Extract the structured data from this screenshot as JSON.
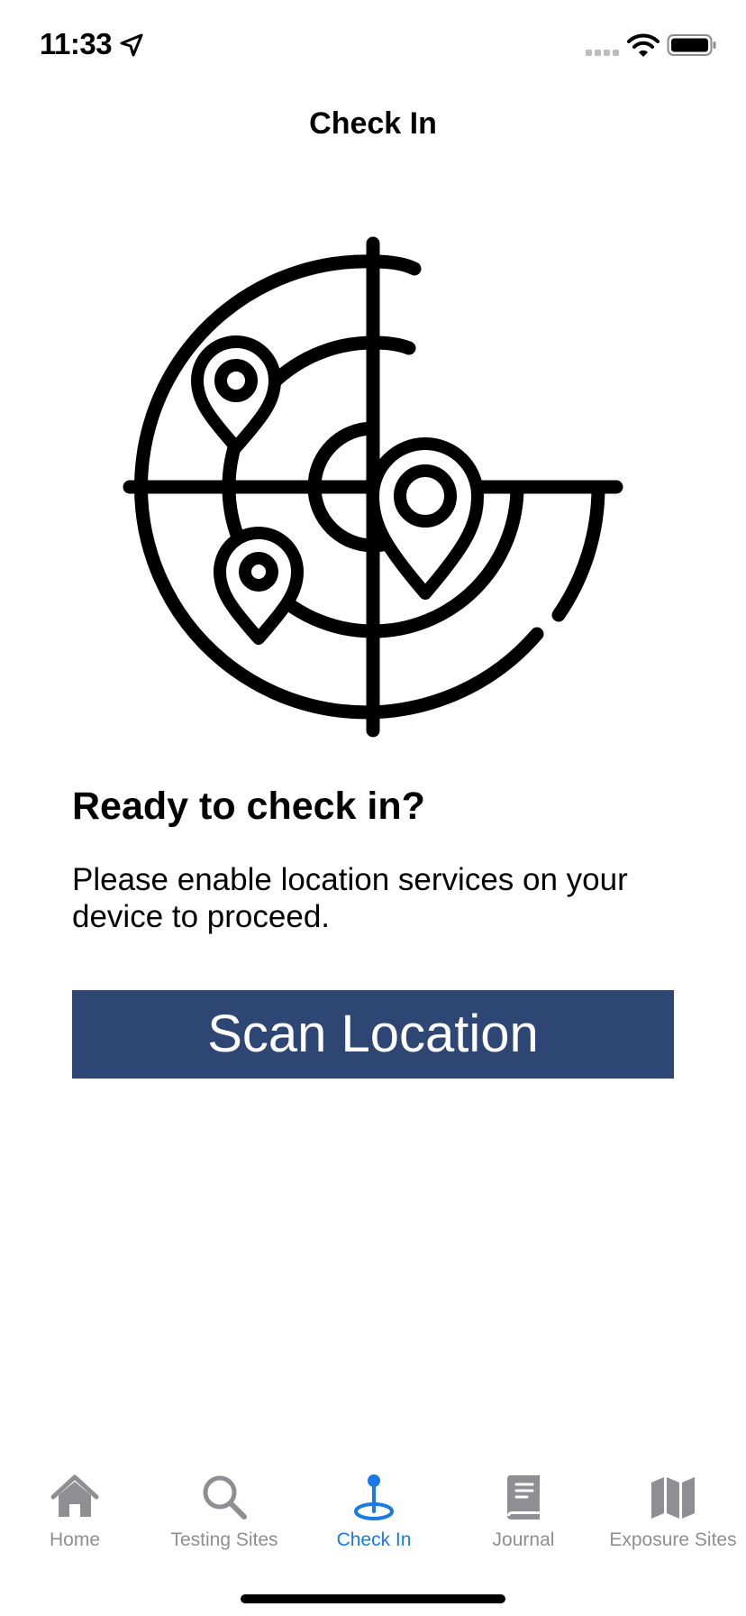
{
  "status_bar": {
    "time": "11:33"
  },
  "nav": {
    "title": "Check In"
  },
  "main": {
    "heading": "Ready to check in?",
    "body": "Please enable location services on your device to proceed.",
    "scan_button": "Scan Location"
  },
  "tabs": [
    {
      "label": "Home",
      "icon": "home-icon"
    },
    {
      "label": "Testing Sites",
      "icon": "search-icon"
    },
    {
      "label": "Check In",
      "icon": "location-pin-icon",
      "active": true
    },
    {
      "label": "Journal",
      "icon": "book-icon"
    },
    {
      "label": "Exposure Sites",
      "icon": "map-icon"
    }
  ],
  "colors": {
    "button_background": "#2E4673",
    "active_tab": "#1a7ae3",
    "inactive_tab": "#8e8e93"
  }
}
